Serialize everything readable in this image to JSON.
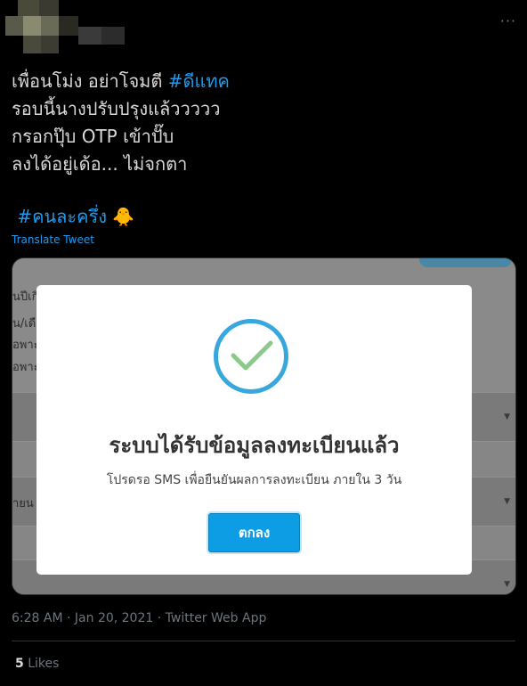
{
  "tweet": {
    "more_label": "···",
    "lines": [
      {
        "text": "เพื่อนโม่ง อย่าโจมตี ",
        "hashtag": "#ดีแทค"
      },
      {
        "text": "รอบนี้นางปรับปรุงแล้ววววว"
      },
      {
        "text": "กรอกปุ๊บ OTP เข้าปั๊บ"
      },
      {
        "text": "ลงได้อยู่เด้อ... ไม่จกตา"
      }
    ],
    "hashtag2": "#คนละครึ่ง",
    "emoji": "🐥",
    "translate_label": "Translate Tweet"
  },
  "card": {
    "bg_texts": [
      "นปีเกิ",
      "น/เดื",
      "อพาะ",
      "อพาะ",
      "ายน"
    ],
    "dialog": {
      "title": "ระบบได้รับข้อมูลลงทะเบียนแล้ว",
      "subtitle": "โปรดรอ SMS เพื่อยืนยันผลการลงทะเบียน ภายใน 3 วัน",
      "ok_label": "ตกลง",
      "check_color": "#37a7dd",
      "button_color": "#0d9de4"
    }
  },
  "meta": {
    "time": "6:28 AM",
    "sep": " · ",
    "date": "Jan 20, 2021",
    "app": "Twitter Web App"
  },
  "stats": {
    "likes_count": "5",
    "likes_label": "Likes"
  },
  "colors": {
    "accent": "#1d9bf0",
    "background": "#000000",
    "muted": "#6e767d"
  }
}
